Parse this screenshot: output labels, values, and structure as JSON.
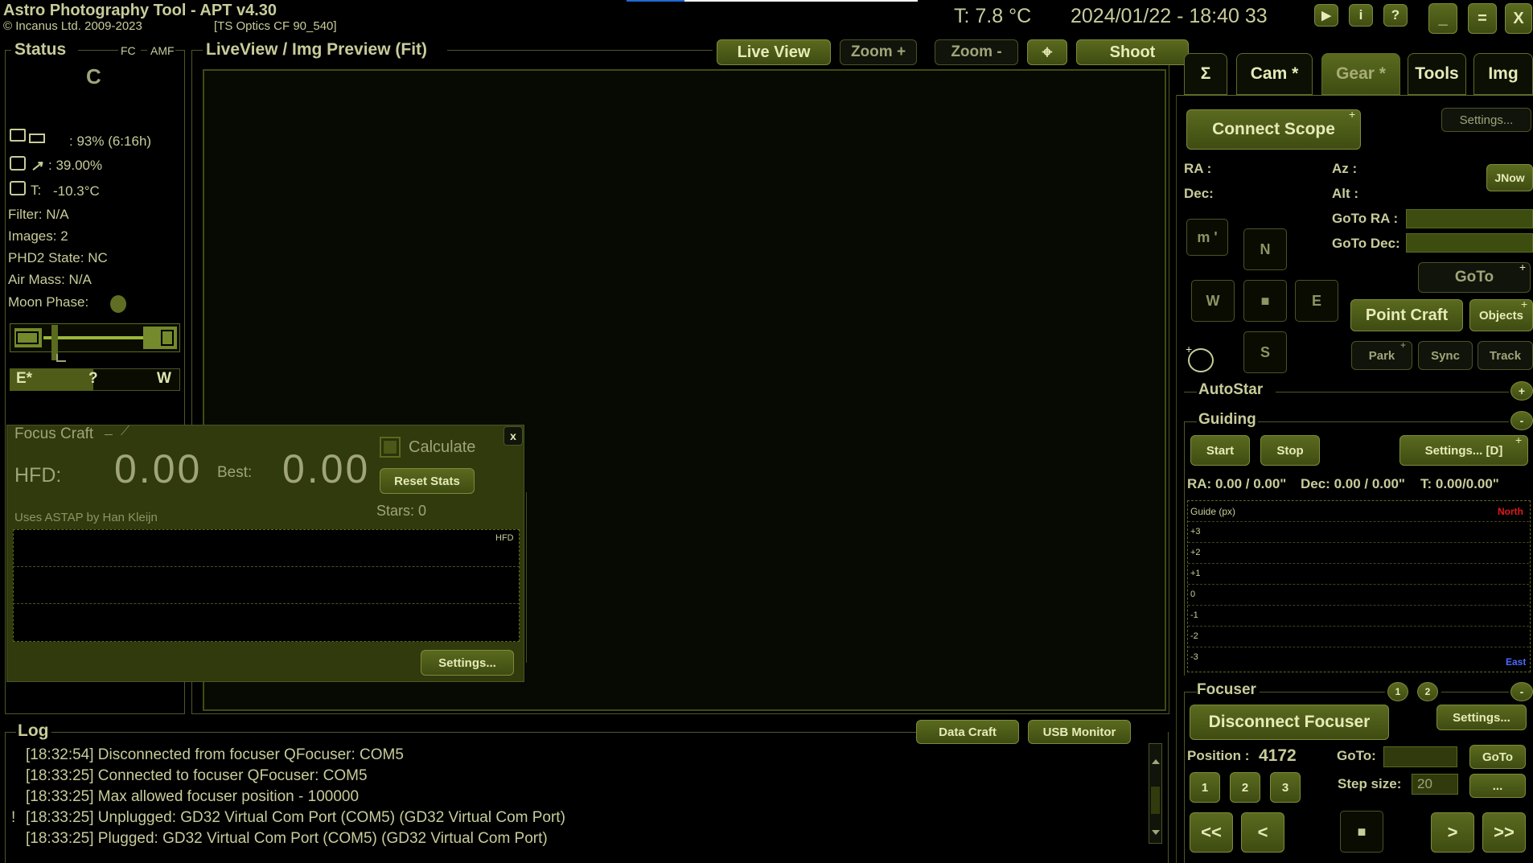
{
  "app": {
    "title": "Astro Photography Tool  -  APT v4.30",
    "copyright": "© Incanus Ltd. 2009-2023",
    "scope_name": "[TS Optics CF 90_540]",
    "temperature": "T: 7.8 °C",
    "datetime": "2024/01/22 - 18:40 33",
    "window_buttons": {
      "play": "▶",
      "info": "i",
      "help": "?",
      "minimize": "_",
      "maximize": "=",
      "close": "X"
    }
  },
  "status": {
    "title": "Status",
    "fc": "FC",
    "amf": "AMF",
    "mode": "C",
    "battery": ": 93% (6:16h)",
    "humidity": ": 39.00%",
    "camera_temp_label": "T:",
    "camera_temp": "-10.3°C",
    "filter": "Filter: N/A",
    "images": "Images: 2",
    "phd2": "PHD2 State: NC",
    "air_mass": "Air Mass: N/A",
    "moon_phase": "Moon Phase:",
    "east_label": "E*",
    "unknown_label": "?",
    "west_label": "W"
  },
  "liveview": {
    "title": "LiveView / Img Preview (Fit)",
    "live_view": "Live View",
    "zoom_in": "Zoom +",
    "zoom_out": "Zoom -",
    "crosshair": "⌖",
    "shoot": "Shoot"
  },
  "focus_craft": {
    "title": "Focus Craft",
    "close": "x",
    "hfd_label": "HFD:",
    "hfd_value": "0.00",
    "best_label": "Best:",
    "best_value": "0.00",
    "calculate": "Calculate",
    "reset_stats": "Reset Stats",
    "credit": "Uses ASTAP by Han Kleijn",
    "stars": "Stars:  0",
    "graph_label": "HFD",
    "settings": "Settings..."
  },
  "tabs": [
    {
      "label": "Σ"
    },
    {
      "label": "Cam *"
    },
    {
      "label": "Gear *"
    },
    {
      "label": "Tools"
    },
    {
      "label": "Img"
    }
  ],
  "gear": {
    "connect_scope": "Connect Scope",
    "settings": "Settings...",
    "ra": "RA :",
    "dec": "Dec:",
    "az": "Az :",
    "alt": "Alt :",
    "jnow": "JNow",
    "goto_ra": "GoTo RA :",
    "goto_dec": "GoTo Dec:",
    "speed": "m '",
    "north": "N",
    "west": "W",
    "stop": "■",
    "east": "E",
    "south": "S",
    "goto": "GoTo",
    "point_craft": "Point Craft",
    "objects": "Objects",
    "park": "Park",
    "sync": "Sync",
    "track": "Track",
    "autostar": "AutoStar",
    "guiding": "Guiding",
    "start": "Start",
    "stop_guiding": "Stop",
    "guide_settings": "Settings... [D]",
    "ra_error": "RA: 0.00 / 0.00\"",
    "dec_error": "Dec: 0.00 / 0.00\"",
    "t_error": "T: 0.00/0.00\"",
    "guide_title": "Guide (px)",
    "north_label": "North",
    "east_label": "East",
    "guide_ticks": [
      "+3",
      "+2",
      "+1",
      "0",
      "-1",
      "-2",
      "-3"
    ],
    "focuser": "Focuser",
    "focuser_1": "1",
    "focuser_2": "2",
    "disconnect_focuser": "Disconnect Focuser",
    "focuser_settings": "Settings...",
    "position_label": "Position :",
    "position_value": "4172",
    "goto_label": "GoTo:",
    "goto_btn": "GoTo",
    "preset_1": "1",
    "preset_2": "2",
    "preset_3": "3",
    "step_size_label": "Step size:",
    "step_size": "20",
    "more": "...",
    "fast_in": "<<",
    "in": "<",
    "out": ">",
    "fast_out": ">>"
  },
  "log": {
    "title": "Log",
    "data_craft": "Data Craft",
    "usb_monitor": "USB Monitor",
    "lines": [
      {
        "mark": "",
        "text": "[18:32:54] Disconnected from focuser QFocuser: COM5"
      },
      {
        "mark": "",
        "text": "[18:33:25] Connected to focuser QFocuser: COM5"
      },
      {
        "mark": "",
        "text": "[18:33:25] Max allowed focuser position -  100000"
      },
      {
        "mark": "!",
        "text": "[18:33:25] Unplugged: GD32 Virtual Com Port (COM5) (GD32 Virtual Com Port)"
      },
      {
        "mark": "",
        "text": "[18:33:25] Plugged: GD32 Virtual Com Port (COM5) (GD32 Virtual Com Port)"
      }
    ]
  }
}
